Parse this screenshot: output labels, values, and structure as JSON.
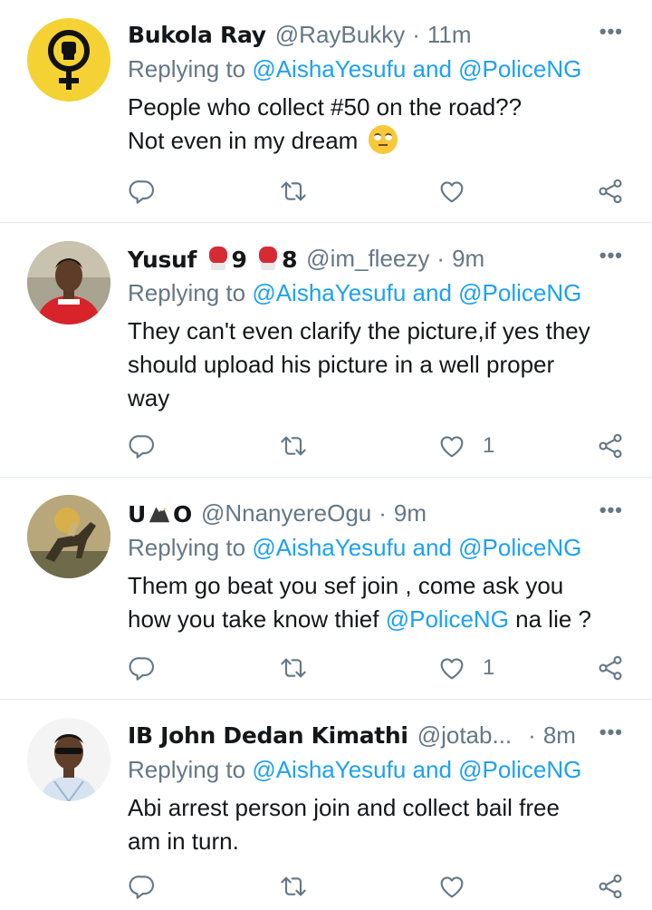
{
  "tweets": [
    {
      "name": "Bukola Ray",
      "handle": "@RayBukky",
      "separator": "·",
      "time": "11m",
      "more": "•••",
      "replying_prefix": "Replying to",
      "replying_to": "@AishaYesufu and @PoliceNG",
      "text_line1": "People who collect #50 on the road??",
      "text_line2": "Not even in my dream",
      "like_count": ""
    },
    {
      "name_part1": "Yusuf",
      "name_num1": "9",
      "name_num2": "8",
      "handle": "@im_fleezy",
      "separator": "·",
      "time": "9m",
      "more": "•••",
      "replying_prefix": "Replying to",
      "replying_to": "@AishaYesufu and @PoliceNG",
      "text_line1": "They can't even clarify the picture,if yes they",
      "text_line2": "should upload his picture in a well proper",
      "text_line3": "way",
      "like_count": "1"
    },
    {
      "name_part1": "U",
      "name_part2": "O",
      "handle": "@NnanyereOgu",
      "separator": "·",
      "time": "9m",
      "more": "•••",
      "replying_prefix": "Replying to",
      "replying_to": "@AishaYesufu and @PoliceNG",
      "text_line1": "Them go beat you sef join , come ask you",
      "text_line2_a": "how you take know thief ",
      "text_line2_mention": "@PoliceNG",
      "text_line2_b": " na lie ?",
      "like_count": "1"
    },
    {
      "name": "IB John Dedan Kimathi",
      "handle": "@jotab...",
      "separator": "·",
      "time": "8m",
      "more": "•••",
      "replying_prefix": "Replying to",
      "replying_to": "@AishaYesufu and @PoliceNG",
      "text_line1": "Abi arrest person join and collect bail free",
      "text_line2": "am in turn.",
      "like_count": ""
    }
  ],
  "icons": {
    "reply": "reply-icon",
    "retweet": "retweet-icon",
    "like": "heart-icon",
    "share": "share-icon",
    "more": "more-icon",
    "emoji": "face-with-rolling-eyes-icon",
    "boxing_glove": "boxing-glove-icon",
    "eagle": "eagle-icon"
  },
  "colors": {
    "link": "#1da1f2",
    "secondary_text": "#657786",
    "divider": "#e1e8ed",
    "avatar1_bg": "#f4d234"
  }
}
